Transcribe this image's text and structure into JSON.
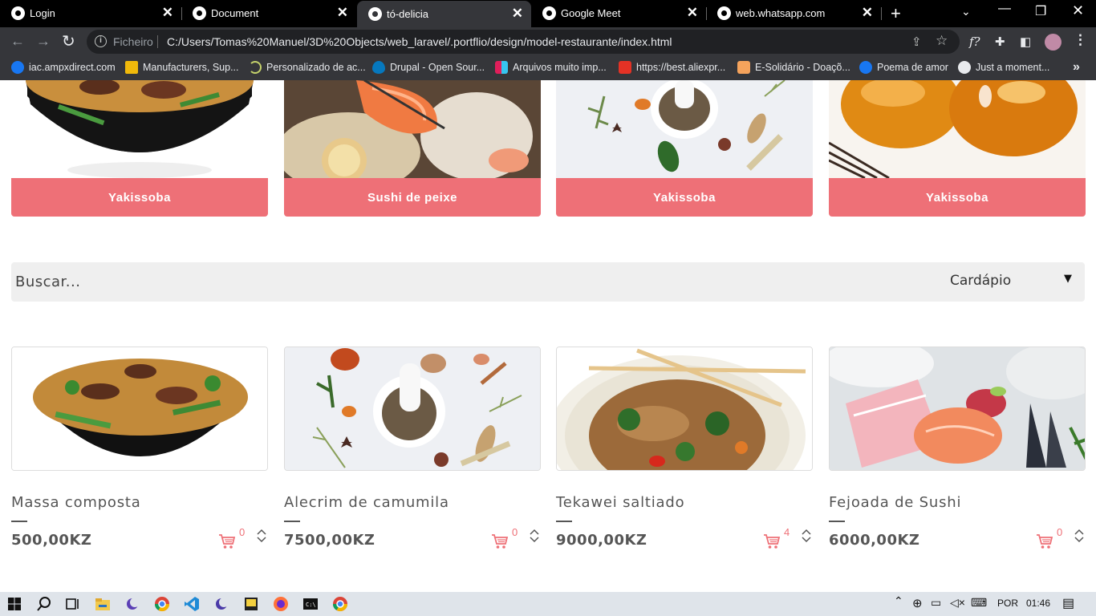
{
  "browser": {
    "tabs": [
      {
        "title": "Login",
        "active": false
      },
      {
        "title": "Document",
        "active": false
      },
      {
        "title": "tó-delicia",
        "active": true
      },
      {
        "title": "Google Meet",
        "active": false
      },
      {
        "title": "web.whatsapp.com",
        "active": false
      }
    ],
    "address": {
      "scheme_label": "Ficheiro",
      "url": "C:/Users/Tomas%20Manuel/3D%20Objects/web_laravel/.portflio/design/model-restaurante/index.html"
    },
    "bookmarks": [
      {
        "label": "iac.ampxdirect.com",
        "icon": "facebook-icon",
        "color": "#1877f2"
      },
      {
        "label": "Manufacturers, Sup...",
        "icon": "alibaba-icon",
        "color": "#f0b90b"
      },
      {
        "label": "Personalizado de ac...",
        "icon": "loading-icon",
        "color": "#c5d26b"
      },
      {
        "label": "Drupal - Open Sour...",
        "icon": "drupal-icon",
        "color": "#0678be"
      },
      {
        "label": "Arquivos muito imp...",
        "icon": "slack-icon",
        "color": "#e01e5a"
      },
      {
        "label": "https://best.aliexpr...",
        "icon": "aliexpress-icon",
        "color": "#e43225"
      },
      {
        "label": "E-Solidário - Doaçõ...",
        "icon": "hand-icon",
        "color": "#f5a35c"
      },
      {
        "label": "Poema de amor",
        "icon": "facebook-icon",
        "color": "#1877f2"
      },
      {
        "label": "Just a moment...",
        "icon": "globe-icon",
        "color": "#e8eaed"
      }
    ]
  },
  "categories": [
    {
      "label": "Yakissoba",
      "image": "noodle-bowl"
    },
    {
      "label": "Sushi de peixe",
      "image": "salmon-sushi"
    },
    {
      "label": "Yakissoba",
      "image": "spices-mortar"
    },
    {
      "label": "Yakissoba",
      "image": "glazed-dessert"
    }
  ],
  "search": {
    "placeholder": "Buscar...",
    "select_value": "Cardápio"
  },
  "products": [
    {
      "name": "Massa composta",
      "price": "500,00KZ",
      "cart_count": "0",
      "image": "noodle-bowl"
    },
    {
      "name": "Alecrim de camumila",
      "price": "7500,00KZ",
      "cart_count": "0",
      "image": "spices-mortar"
    },
    {
      "name": "Tekawei saltiado",
      "price": "9000,00KZ",
      "cart_count": "4",
      "image": "stir-fry-plate"
    },
    {
      "name": "Fejoada de Sushi",
      "price": "6000,00KZ",
      "cart_count": "0",
      "image": "sashimi-plate"
    }
  ],
  "taskbar": {
    "language": "POR",
    "time": "01:46"
  },
  "colors": {
    "accent": "#ee7077",
    "chrome_dark": "#35363a",
    "tab_bar": "#000000"
  }
}
